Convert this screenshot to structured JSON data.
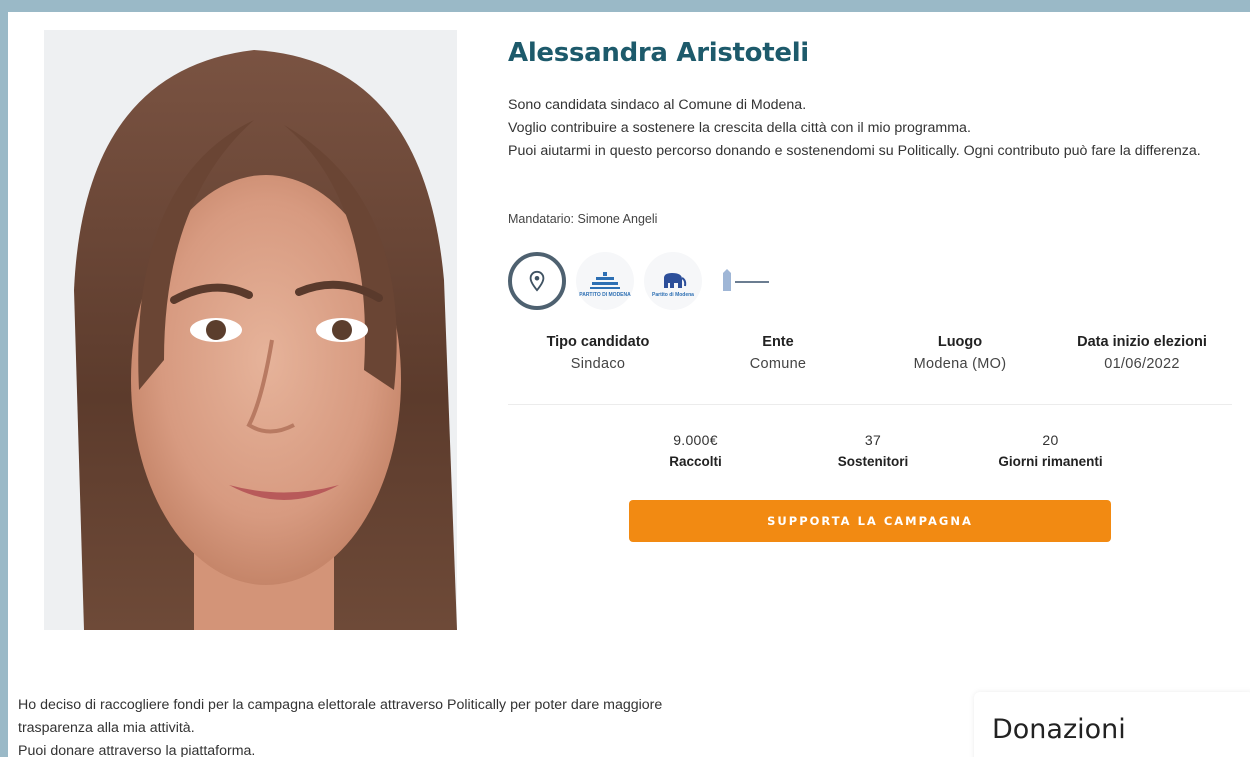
{
  "candidate": {
    "name": "Alessandra Aristoteli",
    "bio": [
      "Sono candidata sindaco al Comune di Modena.",
      "Voglio contribuire a sostenere la crescita della città con il mio programma.",
      "Puoi aiutarmi in questo percorso donando e sostenendomi su Politically. Ogni contributo può fare la differenza."
    ],
    "mandatario": "Mandatario: Simone Angeli"
  },
  "badges": [
    {
      "icon": "location-pin-icon",
      "caption": ""
    },
    {
      "icon": "building-icon",
      "caption": "PARTITO DI MODENA"
    },
    {
      "icon": "elephant-icon",
      "caption": "Partito di Modena"
    },
    {
      "icon": "monument-icon",
      "caption": ""
    }
  ],
  "info": [
    {
      "label": "Tipo candidato",
      "value": "Sindaco"
    },
    {
      "label": "Ente",
      "value": "Comune"
    },
    {
      "label": "Luogo",
      "value": "Modena (MO)"
    },
    {
      "label": "Data inizio elezioni",
      "value": "01/06/2022"
    }
  ],
  "stats": [
    {
      "value": "9.000€",
      "label": "Raccolti"
    },
    {
      "value": "37",
      "label": "Sostenitori"
    },
    {
      "value": "20",
      "label": "Giorni rimanenti"
    }
  ],
  "support_button": "SUPPORTA LA CAMPAGNA",
  "lower_text": [
    "Ho deciso di raccogliere fondi per la campagna elettorale attraverso Politically per poter dare maggiore",
    "trasparenza alla mia attività.",
    "Puoi donare attraverso la piattaforma."
  ],
  "donations_title": "Donazioni",
  "colors": {
    "accent": "#f28a12",
    "name": "#1d5a6b",
    "background": "#9ab9c7"
  }
}
